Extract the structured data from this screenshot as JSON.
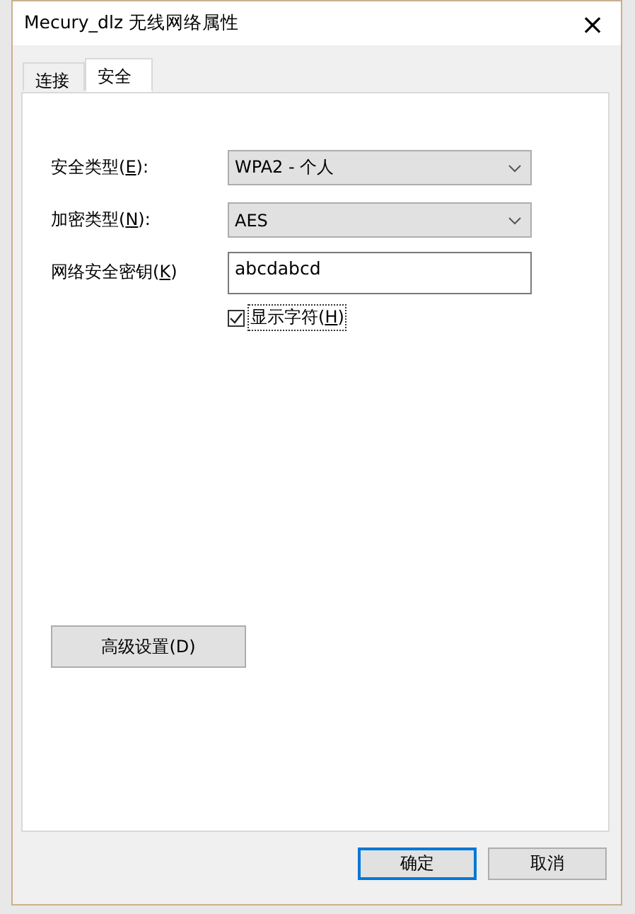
{
  "window": {
    "title": "Mecury_dlz 无线网络属性",
    "close": "×"
  },
  "tabs": [
    {
      "label": "连接",
      "selected": false
    },
    {
      "label": "安全",
      "selected": true
    }
  ],
  "fields": [
    {
      "kind": "dropdown",
      "label": "安全类型(**E**):",
      "value": "WPA2 - 个人"
    },
    {
      "kind": "dropdown",
      "label": "加密类型(**N**):",
      "value": "AES"
    },
    {
      "kind": "text",
      "label": "网络安全密钥(**K**)",
      "value": "abcdabcd"
    }
  ],
  "show_characters": {
    "label": "显示字符(**H**)",
    "checked": true
  },
  "advanced_button": "高级设置(D)",
  "buttons": [
    {
      "label": "确定",
      "selected": true
    },
    {
      "label": "取消",
      "selected": false
    }
  ]
}
